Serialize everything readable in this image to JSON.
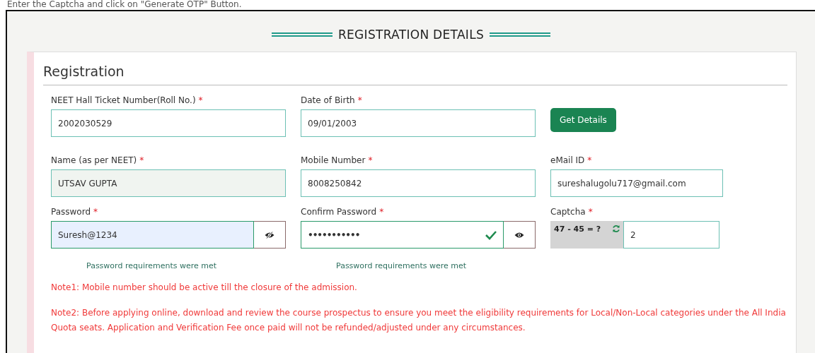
{
  "instruction": "Enter the Captcha and click on \"Generate OTP\" Button.",
  "heading": "REGISTRATION DETAILS",
  "section_title": "Registration",
  "rows": [
    [
      {
        "kind": "text",
        "label": "NEET Hall Ticket Number(Roll No.)",
        "required": "*",
        "value": "2002030529",
        "readonly": false
      },
      {
        "kind": "text",
        "label": "Date of Birth",
        "required": "*",
        "value": "09/01/2003",
        "readonly": false
      },
      {
        "kind": "button",
        "text": "Get Details"
      }
    ],
    [
      {
        "kind": "text",
        "label": "Name (as per NEET)",
        "required": "*",
        "value": "UTSAV GUPTA",
        "readonly": true
      },
      {
        "kind": "text",
        "label": "Mobile Number",
        "required": "*",
        "value": "8008250842",
        "readonly": false
      },
      {
        "kind": "text",
        "label": "eMail ID",
        "required": "*",
        "value": "sureshalugolu717@gmail.com",
        "readonly": false
      }
    ],
    [
      {
        "kind": "password",
        "label": "Password",
        "required": "*",
        "value": "Suresh@1234",
        "revealed": true,
        "autofilled": true,
        "valid": false,
        "hint": "Password requirements were met"
      },
      {
        "kind": "password",
        "label": "Confirm Password",
        "required": "*",
        "value": "•••••••••••",
        "revealed": false,
        "autofilled": false,
        "valid": true,
        "hint": "Password requirements were met"
      },
      {
        "kind": "captcha",
        "label": "Captcha",
        "required": "*",
        "question": "47 - 45 = ?",
        "value": "2"
      }
    ]
  ],
  "notes": [
    "Note1: Mobile number should be active till the closure of the admission.",
    "Note2: Before applying online, download and review the course prospectus to ensure you meet the eligibility requirements for Local/Non-Local categories under the All India Quota seats. Application and Verification Fee once paid will not be refunded/adjusted under any circumstances."
  ]
}
